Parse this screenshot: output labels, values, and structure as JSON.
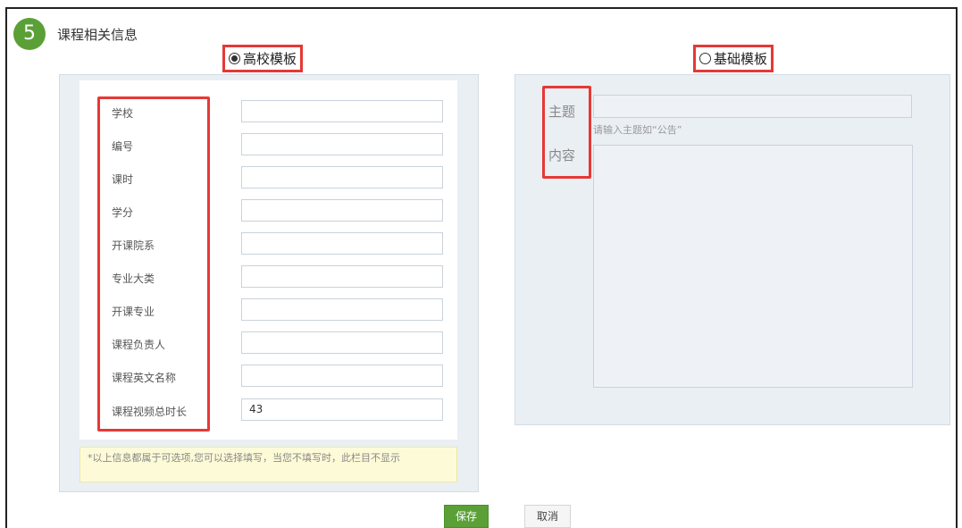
{
  "section": {
    "step": "5",
    "title": "课程相关信息"
  },
  "templates": {
    "gaoxiao": {
      "label": "高校模板",
      "selected": true
    },
    "jichu": {
      "label": "基础模板",
      "selected": false
    }
  },
  "gaoxiao_form": {
    "fields": [
      {
        "label": "学校",
        "value": ""
      },
      {
        "label": "编号",
        "value": ""
      },
      {
        "label": "课时",
        "value": ""
      },
      {
        "label": "学分",
        "value": ""
      },
      {
        "label": "开课院系",
        "value": ""
      },
      {
        "label": "专业大类",
        "value": ""
      },
      {
        "label": "开课专业",
        "value": ""
      },
      {
        "label": "课程负责人",
        "value": ""
      },
      {
        "label": "课程英文名称",
        "value": ""
      },
      {
        "label": "课程视频总时长",
        "value": "43"
      }
    ],
    "note": "*以上信息都属于可选项,您可以选择填写，当您不填写时，此栏目不显示"
  },
  "jichu_form": {
    "subject_label": "主题",
    "subject_hint": "请输入主题如“公告”",
    "content_label": "内容"
  },
  "buttons": {
    "save": "保存",
    "cancel": "取消"
  },
  "colors": {
    "accent": "#5aa037",
    "highlight": "#e53935",
    "panel": "#eaeff4"
  }
}
